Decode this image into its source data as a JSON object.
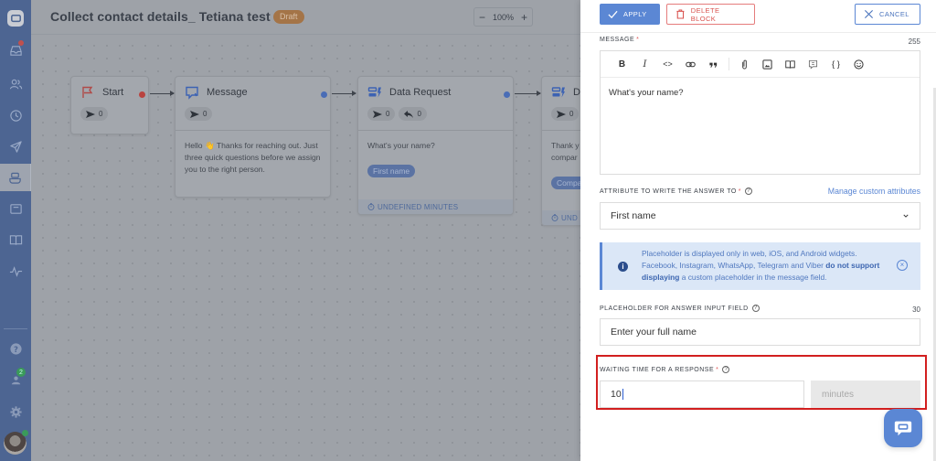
{
  "header": {
    "title": "Collect contact details_ Tetiana test",
    "status_badge": "Draft",
    "zoom": {
      "minus": "−",
      "level": "100%",
      "plus": "+"
    }
  },
  "sidebar": {
    "items": [
      {
        "name": "inbox",
        "icon": "inbox-icon",
        "has_notification": true
      },
      {
        "name": "contacts",
        "icon": "users-icon"
      },
      {
        "name": "history",
        "icon": "clock-icon"
      },
      {
        "name": "campaigns",
        "icon": "send-icon"
      },
      {
        "name": "chatbots",
        "icon": "bot-icon",
        "active": true
      },
      {
        "name": "widgets",
        "icon": "window-icon"
      },
      {
        "name": "knowledge-base",
        "icon": "book-icon"
      },
      {
        "name": "analytics",
        "icon": "activity-icon"
      }
    ],
    "bottom": [
      {
        "name": "help",
        "icon": "question-icon"
      },
      {
        "name": "team",
        "icon": "team-icon",
        "badge": "2"
      },
      {
        "name": "settings",
        "icon": "gear-icon"
      }
    ],
    "avatar_online": true
  },
  "canvas": {
    "nodes": [
      {
        "title": "Start",
        "sent": "0"
      },
      {
        "title": "Message",
        "sent": "0",
        "body": "Hello 👋 Thanks for reaching out. Just three quick questions before we assign you to the right person."
      },
      {
        "title": "Data Request",
        "sent": "0",
        "replies": "0",
        "body": "What's your name?",
        "attribute": "First name",
        "footer": "UNDEFINED MINUTES"
      },
      {
        "title": "D",
        "sent": "0",
        "body_line1": "Thank y",
        "body_line2": "compar",
        "attribute": "Compa",
        "footer": "UND"
      }
    ]
  },
  "panel": {
    "apply_label": "APPLY",
    "delete_label": "DELETE BLOCK",
    "cancel_label": "CANCEL",
    "message": {
      "label": "MESSAGE",
      "required": "*",
      "counter": "255",
      "toolbar": [
        "B",
        "I",
        "<>",
        "link",
        "quote",
        "attach",
        "image",
        "book",
        "note",
        "{ }",
        "emoji"
      ],
      "value": "What's your name?"
    },
    "attribute": {
      "label": "ATTRIBUTE TO WRITE THE ANSWER TO",
      "required": "*",
      "manage_link": "Manage custom attributes",
      "selected": "First name"
    },
    "info": {
      "text_before": "Placeholder is displayed only in web, iOS, and Android widgets. Facebook, Instagram, WhatsApp, Telegram and Viber ",
      "bold": "do not support displaying",
      "text_after": " a custom placeholder in the message field."
    },
    "placeholder_field": {
      "label": "PLACEHOLDER FOR ANSWER INPUT FIELD",
      "counter": "30",
      "value": "Enter your full name"
    },
    "waiting": {
      "label": "WAITING TIME FOR A RESPONSE",
      "required": "*",
      "value": "10",
      "unit_placeholder": "minutes"
    }
  },
  "colors": {
    "accent": "#5b87d4",
    "danger": "#d9534f",
    "highlight_border": "#d21f1f",
    "sidebar": "#4d6592"
  }
}
